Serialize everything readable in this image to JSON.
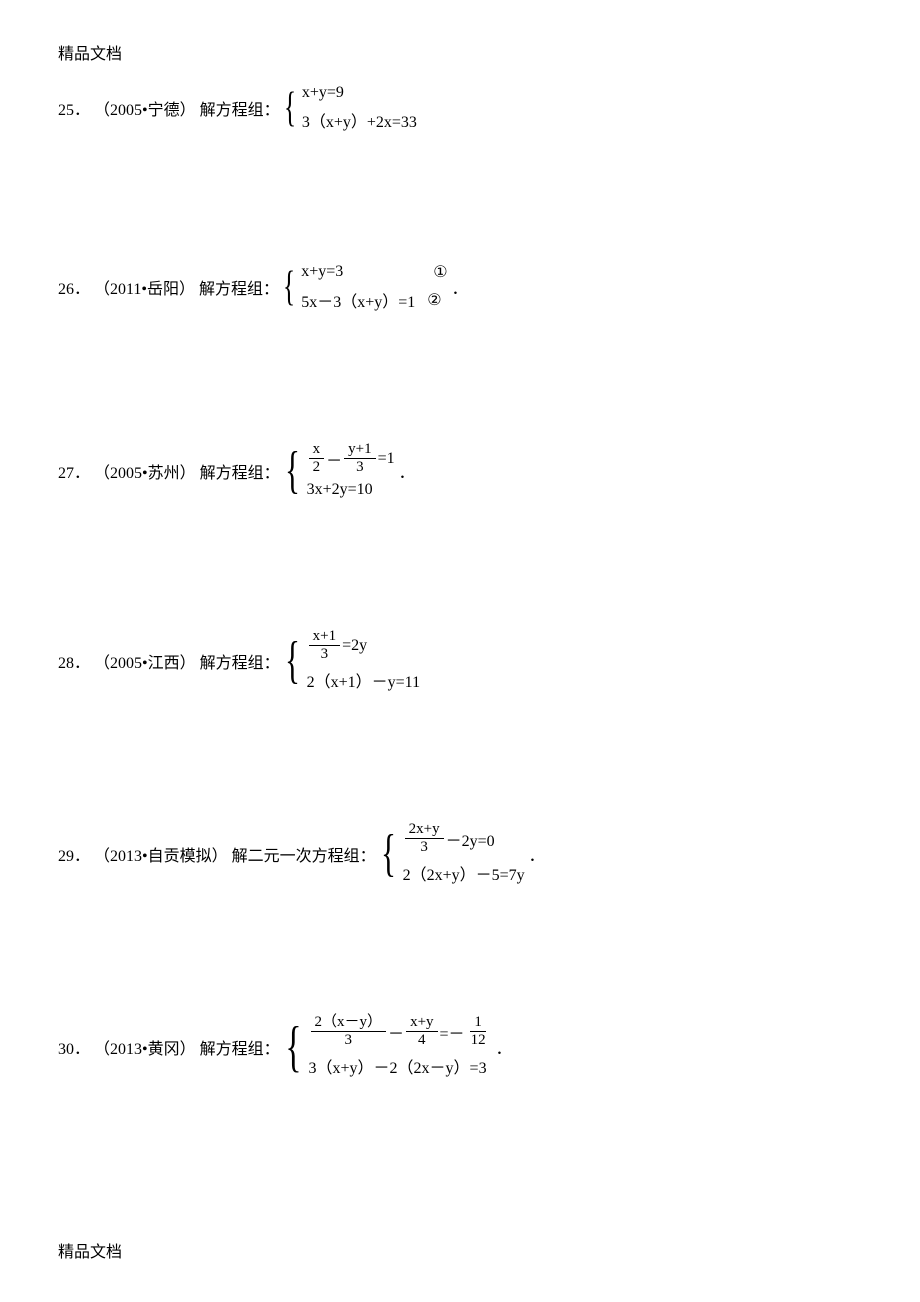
{
  "header": "精品文档",
  "footer": "精品文档",
  "problems": [
    {
      "num": "25",
      "source": "（2005•宁德）",
      "prompt": "解方程组：",
      "eq1_parts": [
        "x+y=9"
      ],
      "eq2_parts": [
        "3（x+y）+2x=33"
      ],
      "suffix": ""
    },
    {
      "num": "26",
      "source": "（2011•岳阳）",
      "prompt": "解方程组：",
      "eq1_parts": [
        "x+y=3"
      ],
      "eq1_circle": "①",
      "eq2_parts": [
        "5x－3（x+y）=1"
      ],
      "eq2_circle": "②",
      "suffix": "．"
    },
    {
      "num": "27",
      "source": "（2005•苏州）",
      "prompt": "解方程组：",
      "eq1_frac1_num": "x",
      "eq1_frac1_den": "2",
      "eq1_mid": "－",
      "eq1_frac2_num": "y+1",
      "eq1_frac2_den": "3",
      "eq1_tail": "=1",
      "eq2_parts": [
        "3x+2y=10"
      ],
      "suffix": "．"
    },
    {
      "num": "28",
      "source": "（2005•江西）",
      "prompt": "解方程组：",
      "eq1_frac1_num": "x+1",
      "eq1_frac1_den": "3",
      "eq1_tail": "=2y",
      "eq2_parts": [
        "2（x+1）－y=11"
      ],
      "suffix": ""
    },
    {
      "num": "29",
      "source": "（2013•自贡模拟）",
      "prompt": "解二元一次方程组：",
      "eq1_frac1_num": "2x+y",
      "eq1_frac1_den": "3",
      "eq1_tail": "－2y=0",
      "eq2_parts": [
        "2（2x+y）－5=7y"
      ],
      "suffix": "．"
    },
    {
      "num": "30",
      "source": "（2013•黄冈）",
      "prompt": "解方程组：",
      "eq1_frac1_num": "2（x－y）",
      "eq1_frac1_den": "3",
      "eq1_mid": "－",
      "eq1_frac2_num": "x+y",
      "eq1_frac2_den": "4",
      "eq1_mid2": "=－",
      "eq1_frac3_num": "1",
      "eq1_frac3_den": "12",
      "eq2_parts": [
        "3（x+y）－2（2x－y）=3"
      ],
      "suffix": "．"
    }
  ],
  "labels": {
    "dot": "．"
  }
}
